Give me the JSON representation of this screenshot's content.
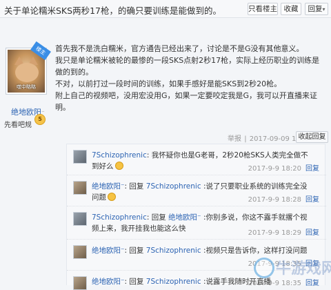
{
  "thread": {
    "title": "关于单论糯米SKS两秒17枪，的确只要训练是能做到的。",
    "buttons": {
      "only_owner": "只看楼主",
      "favorite": "收藏",
      "reply": "回复"
    }
  },
  "author": {
    "name": "绝地欧阳",
    "name_mark": "⁻",
    "rank": "先看吧规",
    "level": "5",
    "badge": "楼主",
    "avatar_caption": "噬中略略"
  },
  "post": {
    "paragraphs": [
      "首先我不是洗白糯米，官方通告已经出来了，讨论是不是G没有其他意义。",
      "我只是单论糯米被轮的最惨的一段SKS点射2秒17枪，实际上经历职业的训练是做的到的。",
      "不对，以前打过一段时间的训练，如果手感好是能SKS到2秒20枪。",
      "附上自己的视频吧，没用宏没用G，如果一定要咬定我是G，我可以开直播来证明。"
    ],
    "report": "举报",
    "sep": "|",
    "time": "2017-09-09 18:16",
    "collapse_reply": "收起回复"
  },
  "subreplies": [
    {
      "user": "7Schizophrenic",
      "prefix": "",
      "target": "",
      "content": ": 我怀疑你也是G老哥，2秒20枪SKS人类完全做不到好么",
      "emoji": true,
      "time": "2017-9-9 18:20",
      "reply": "回复"
    },
    {
      "user": "绝地欧阳⁻",
      "prefix": ": 回复 ",
      "target": "7Schizophrenic",
      "content": " :说了只要职业系统的训练完全没问题",
      "emoji": true,
      "time": "2017-9-9 18:28",
      "reply": "回复"
    },
    {
      "user": "7Schizophrenic",
      "prefix": ": 回复 ",
      "target": "绝地欧阳⁻",
      "content": " :你别多说，你这不露手就撂个视频上来，我开挂我也能这么快",
      "emoji": false,
      "time": "2017-9-9 18:29",
      "reply": "回复"
    },
    {
      "user": "绝地欧阳⁻",
      "prefix": ": 回复 ",
      "target": "7Schizophrenic",
      "content": " :视频只是告诉你，这样打没问题",
      "emoji": false,
      "time": "2017-9-9 18:35",
      "reply": "回复"
    },
    {
      "user": "绝地欧阳⁻",
      "prefix": ": 回复 ",
      "target": "7Schizophrenic",
      "content": " :说露手我随时开直播",
      "emoji": false,
      "time": "2017-9-9 18:35",
      "reply": "回复"
    }
  ],
  "watermark": {
    "text": "牛游戏网"
  },
  "colors": {
    "link": "#2d64b3",
    "meta": "#999999",
    "badge": "#3a8ee6"
  }
}
